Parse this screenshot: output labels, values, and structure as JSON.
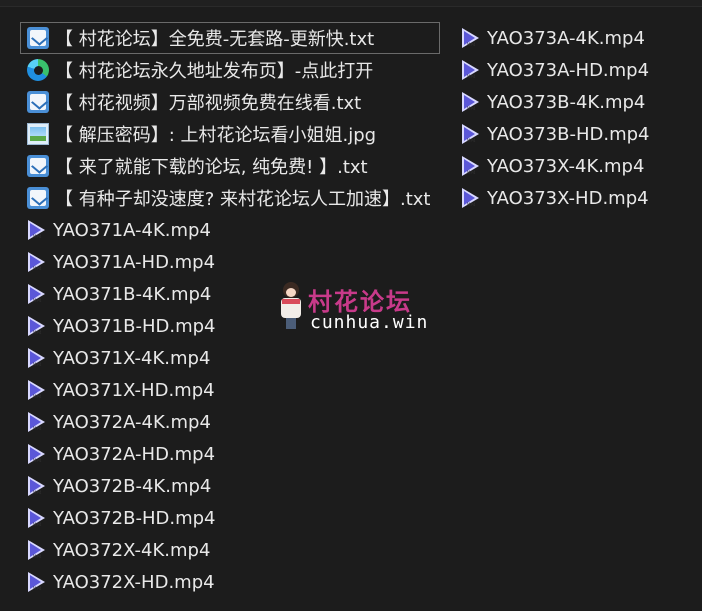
{
  "files_col1": [
    {
      "name": "【 村花论坛】全免费-无套路-更新快.txt",
      "type": "txt",
      "selected": true
    },
    {
      "name": "【 村花论坛永久地址发布页】-点此打开",
      "type": "url"
    },
    {
      "name": "【 村花视频】万部视频免费在线看.txt",
      "type": "txt"
    },
    {
      "name": "【 解压密码】: 上村花论坛看小姐姐.jpg",
      "type": "jpg"
    },
    {
      "name": "【 来了就能下载的论坛, 纯免费! 】.txt",
      "type": "txt"
    },
    {
      "name": "【 有种子却没速度? 来村花论坛人工加速】.txt",
      "type": "txt"
    },
    {
      "name": "YAO371A-4K.mp4",
      "type": "mp4"
    },
    {
      "name": "YAO371A-HD.mp4",
      "type": "mp4"
    },
    {
      "name": "YAO371B-4K.mp4",
      "type": "mp4"
    },
    {
      "name": "YAO371B-HD.mp4",
      "type": "mp4"
    },
    {
      "name": "YAO371X-4K.mp4",
      "type": "mp4"
    },
    {
      "name": "YAO371X-HD.mp4",
      "type": "mp4"
    },
    {
      "name": "YAO372A-4K.mp4",
      "type": "mp4"
    },
    {
      "name": "YAO372A-HD.mp4",
      "type": "mp4"
    },
    {
      "name": "YAO372B-4K.mp4",
      "type": "mp4"
    },
    {
      "name": "YAO372B-HD.mp4",
      "type": "mp4"
    },
    {
      "name": "YAO372X-4K.mp4",
      "type": "mp4"
    },
    {
      "name": "YAO372X-HD.mp4",
      "type": "mp4"
    }
  ],
  "files_col2": [
    {
      "name": "YAO373A-4K.mp4",
      "type": "mp4"
    },
    {
      "name": "YAO373A-HD.mp4",
      "type": "mp4"
    },
    {
      "name": "YAO373B-4K.mp4",
      "type": "mp4"
    },
    {
      "name": "YAO373B-HD.mp4",
      "type": "mp4"
    },
    {
      "name": "YAO373X-4K.mp4",
      "type": "mp4"
    },
    {
      "name": "YAO373X-HD.mp4",
      "type": "mp4"
    }
  ],
  "watermark": {
    "title": "村花论坛",
    "subtitle": "cunhua.win"
  },
  "colors": {
    "background": "#1c1c1c",
    "text": "#e8e8e8",
    "selection_border": "#6a6a6a",
    "watermark_title": "#c83a8a"
  }
}
